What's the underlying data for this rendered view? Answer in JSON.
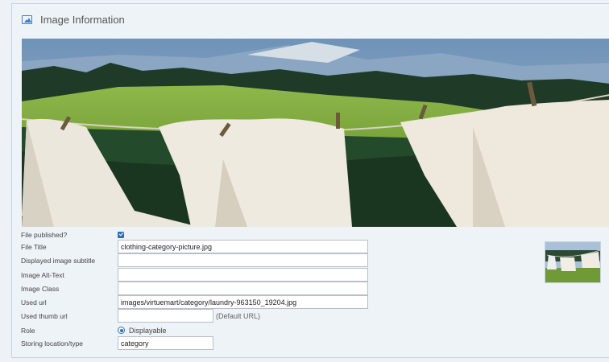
{
  "panel": {
    "title": "Image Information",
    "icon": "image-icon"
  },
  "form": {
    "published": {
      "label": "File published?",
      "checked": true
    },
    "file_title": {
      "label": "File Title",
      "value": "clothing-category-picture.jpg"
    },
    "subtitle": {
      "label": "Displayed image subtitle",
      "value": ""
    },
    "alt_text": {
      "label": "Image Alt-Text",
      "value": ""
    },
    "image_class": {
      "label": "Image Class",
      "value": ""
    },
    "used_url": {
      "label": "Used url",
      "value": "images/virtuemart/category/laundry-963150_19204.jpg"
    },
    "thumb_url": {
      "label": "Used thumb url",
      "value": "",
      "hint": "(Default URL)"
    },
    "role": {
      "label": "Role",
      "option": "Displayable"
    },
    "storing": {
      "label": "Storing location/type",
      "value": "category"
    }
  },
  "colors": {
    "accent": "#2f6fb5",
    "panel_bg": "#eef3f8",
    "border": "#c9d2dc"
  }
}
